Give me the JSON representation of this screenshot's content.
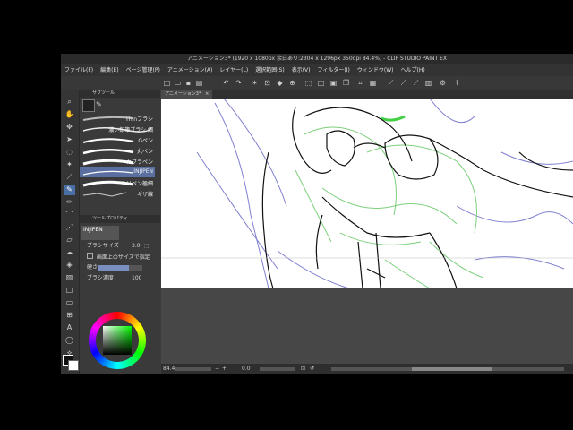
{
  "title": "アニメーション3* (1920 x 1080px 余白あり:2304 x 1296px 350dpi 84.4%) - CLIP STUDIO PAINT EX",
  "menu": [
    "ファイル(F)",
    "編集(E)",
    "ページ管理(P)",
    "アニメーション(A)",
    "レイヤー(L)",
    "選択範囲(S)",
    "表示(V)",
    "フィルター(I)",
    "ウィンドウ(W)",
    "ヘルプ(H)"
  ],
  "subtool_panel": {
    "title": "サブツール"
  },
  "brushes": [
    "Thinブラシ",
    "濃い鉛筆ブラシ 細",
    "Gペン",
    "丸ペン",
    "カブラペン",
    "INJIPEN",
    "ミリペン極細",
    "ギザ線"
  ],
  "selected_brush_index": 5,
  "tool_property": {
    "title": "ツールプロパティ",
    "brush_name": "INJIPEN",
    "brush_size_label": "ブラシサイズ",
    "brush_size_value": "3.0",
    "screen_size_label": "画面上のサイズで指定",
    "hardness_label": "硬さ",
    "density_label": "ブラシ濃度",
    "density_value": "100"
  },
  "document_tab": "アニメーション3*",
  "status": {
    "zoom": "84.4",
    "angle": "0.0"
  },
  "colors": {
    "main": "#111111",
    "sub": "#ffffff",
    "accent": "#4a6fa5"
  }
}
